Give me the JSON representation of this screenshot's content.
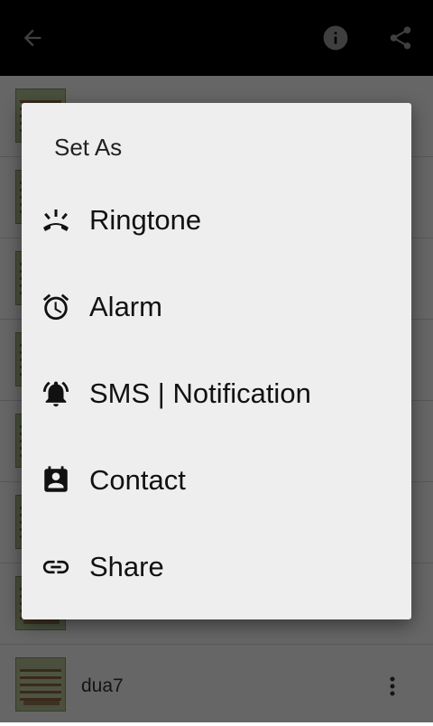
{
  "appbar": {
    "icons": [
      "back-arrow-icon",
      "info-icon",
      "share-icon"
    ],
    "color": "#000000",
    "icon_color": "#9e9e9e"
  },
  "list": {
    "items": [
      {
        "name": ""
      },
      {
        "name": ""
      },
      {
        "name": ""
      },
      {
        "name": ""
      },
      {
        "name": ""
      },
      {
        "name": ""
      },
      {
        "name": ""
      },
      {
        "name": "dua7"
      }
    ]
  },
  "dialog": {
    "title": "Set As",
    "options": [
      {
        "label": "Ringtone",
        "icon": "ringtone-phone-icon"
      },
      {
        "label": "Alarm",
        "icon": "alarm-clock-icon"
      },
      {
        "label": "SMS | Notification",
        "icon": "notification-bell-icon"
      },
      {
        "label": "Contact",
        "icon": "contact-card-icon"
      },
      {
        "label": "Share",
        "icon": "link-icon"
      }
    ]
  },
  "colors": {
    "dialog_bg": "#eeeeee",
    "scrim": "rgba(0,0,0,0.6)"
  }
}
